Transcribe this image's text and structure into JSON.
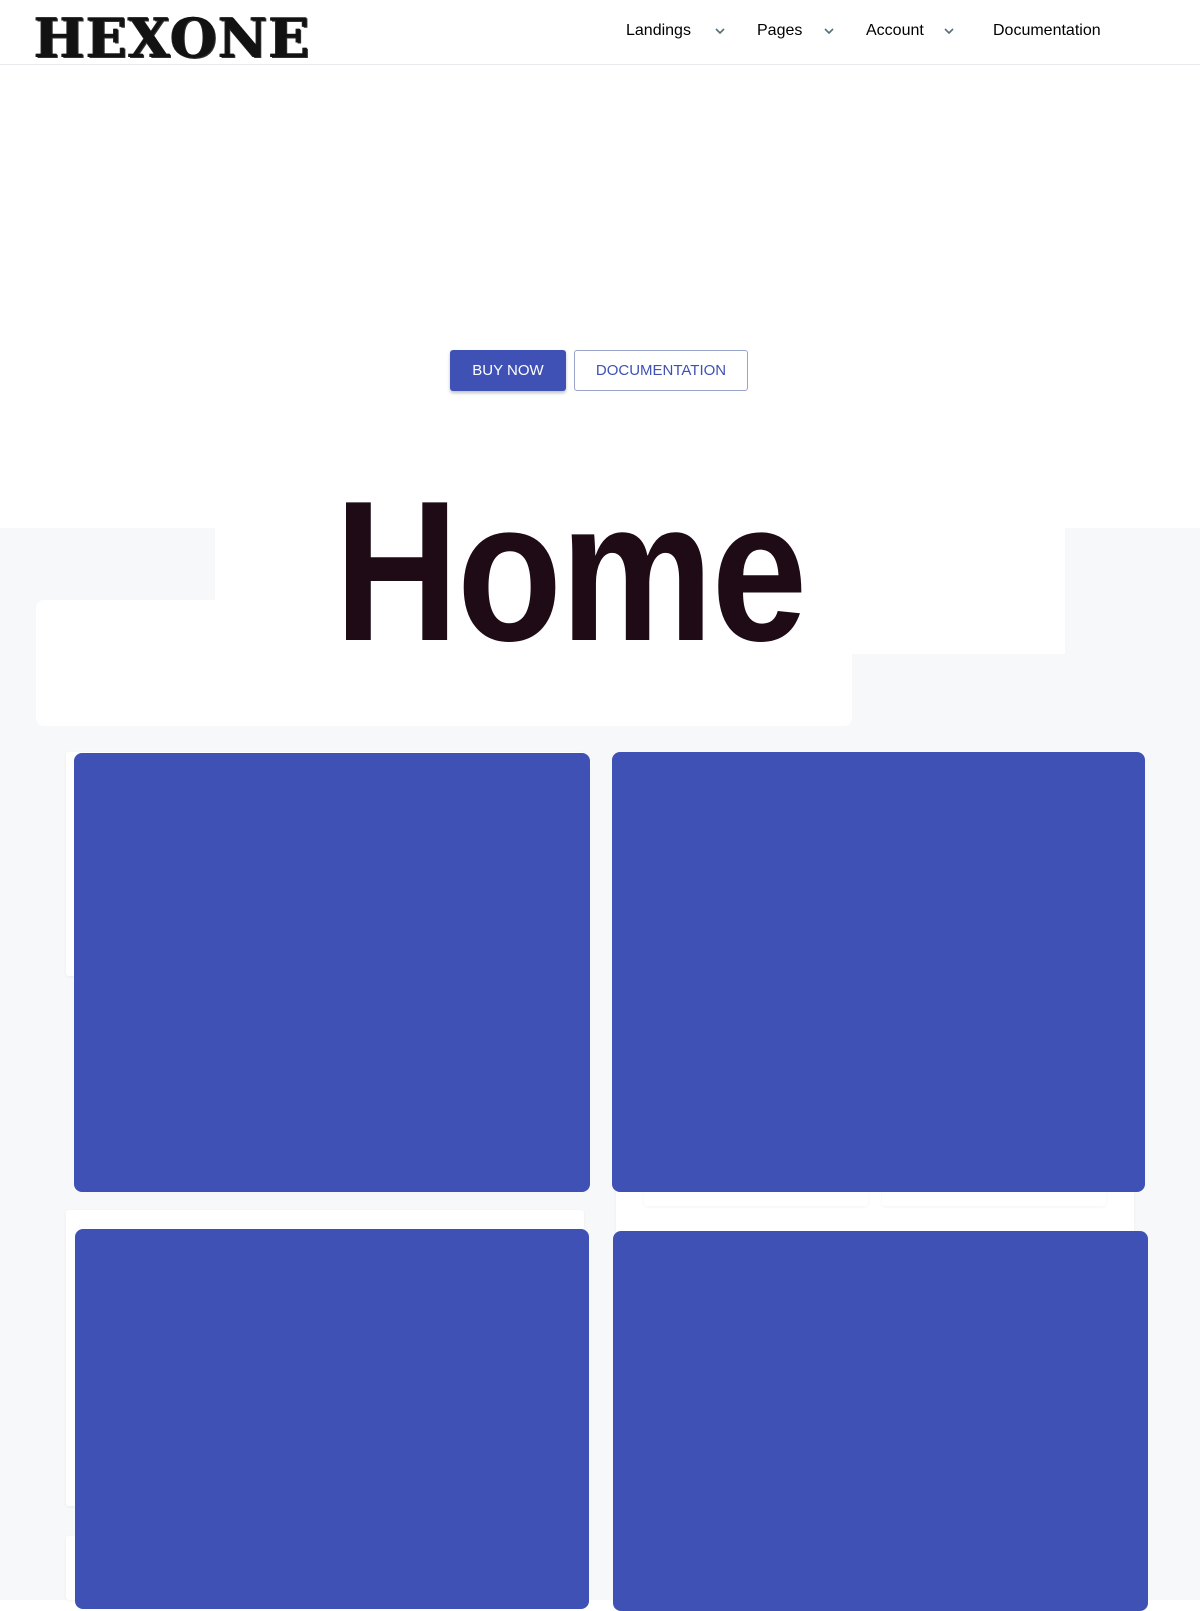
{
  "brand": {
    "logo_text": "HEXONE"
  },
  "nav": {
    "items": [
      {
        "label": "Landings",
        "has_dropdown": true
      },
      {
        "label": "Pages",
        "has_dropdown": true
      },
      {
        "label": "Account",
        "has_dropdown": true
      },
      {
        "label": "Documentation",
        "has_dropdown": false
      }
    ]
  },
  "hero": {
    "buy_label": "BUY NOW",
    "docs_label": "DOCUMENTATION",
    "title": "Home"
  },
  "colors": {
    "primary": "#3f51b5",
    "nav_text": "#546e7a",
    "title_text": "#1e0b16",
    "section_bg": "#f7f8fa"
  },
  "icons": {
    "dropdown": "chevron-down-icon"
  }
}
